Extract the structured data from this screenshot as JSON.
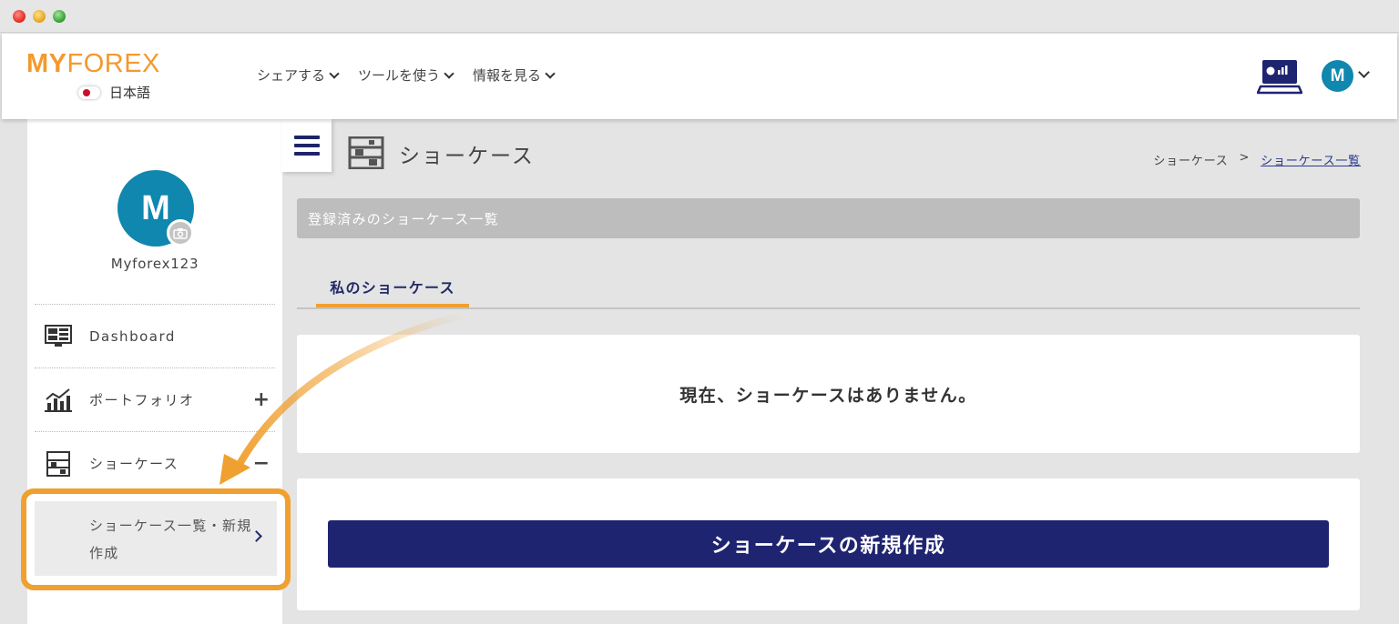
{
  "brand": {
    "logo_bold": "MY",
    "logo_light": "FOREX"
  },
  "language": {
    "label": "日本語"
  },
  "nav": {
    "items": [
      {
        "label": "シェアする"
      },
      {
        "label": "ツールを使う"
      },
      {
        "label": "情報を見る"
      }
    ]
  },
  "user": {
    "initial": "M",
    "name": "Myforex123"
  },
  "sidebar": {
    "items": [
      {
        "label": "Dashboard",
        "toggle": ""
      },
      {
        "label": "ポートフォリオ",
        "toggle": "+"
      },
      {
        "label": "ショーケース",
        "toggle": "−"
      }
    ],
    "submenu": {
      "label": "ショーケース一覧・新規作成"
    }
  },
  "page": {
    "title": "ショーケース",
    "breadcrumb": {
      "parent": "ショーケース",
      "separator": ">",
      "current": "ショーケース一覧"
    },
    "section_title": "登録済みのショーケース一覧",
    "tab_label": "私のショーケース",
    "empty_message": "現在、ショーケースはありません。",
    "create_button": "ショーケースの新規作成"
  },
  "colors": {
    "accent": "#f0a030",
    "navy": "#1f2470",
    "avatar": "#0f87ae"
  }
}
